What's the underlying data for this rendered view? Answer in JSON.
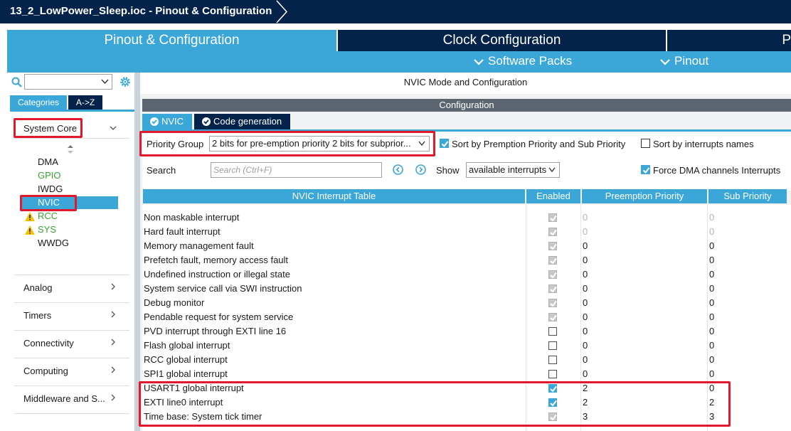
{
  "window": {
    "title": "13_2_LowPower_Sleep.ioc - Pinout & Configuration"
  },
  "main_tabs": [
    {
      "label": "Pinout & Configuration",
      "active": true
    },
    {
      "label": "Clock Configuration",
      "active": false
    },
    {
      "label": "P",
      "active": false
    }
  ],
  "sub_menu": {
    "software_packs": "Software Packs",
    "pinout": "Pinout"
  },
  "left": {
    "search_value": "",
    "category_tabs": [
      "Categories",
      "A->Z"
    ],
    "groups": {
      "system_core": "System Core",
      "analog": "Analog",
      "timers": "Timers",
      "connectivity": "Connectivity",
      "computing": "Computing",
      "middleware": "Middleware and S..."
    },
    "system_core_items": [
      {
        "label": "DMA",
        "status": "normal"
      },
      {
        "label": "GPIO",
        "status": "configured"
      },
      {
        "label": "IWDG",
        "status": "normal"
      },
      {
        "label": "NVIC",
        "status": "selected"
      },
      {
        "label": "RCC",
        "status": "warning"
      },
      {
        "label": "SYS",
        "status": "warning"
      },
      {
        "label": "WWDG",
        "status": "normal"
      }
    ]
  },
  "main": {
    "mode_title": "NVIC Mode and Configuration",
    "config_label": "Configuration",
    "sub_tabs": [
      "NVIC",
      "Code generation"
    ],
    "priority_group_label": "Priority Group",
    "priority_group_value": "2 bits for pre-emption priority 2 bits for subprior...",
    "sort_premption_label": "Sort by Premption Priority and Sub Priority",
    "sort_premption_checked": true,
    "sort_names_label": "Sort by interrupts names",
    "sort_names_checked": false,
    "search_label": "Search",
    "search_placeholder": "Search (Ctrl+F)",
    "show_label": "Show",
    "show_value": "available interrupts",
    "force_dma_label": "Force DMA channels Interrupts",
    "force_dma_checked": true
  },
  "table": {
    "headers": [
      "NVIC Interrupt Table",
      "Enabled",
      "Preemption Priority",
      "Sub Priority"
    ],
    "rows": [
      {
        "name": "Non maskable interrupt",
        "enabled": true,
        "enabled_locked": true,
        "preemption": "0",
        "sub": "0",
        "prio_locked": true
      },
      {
        "name": "Hard fault interrupt",
        "enabled": true,
        "enabled_locked": true,
        "preemption": "0",
        "sub": "0",
        "prio_locked": true
      },
      {
        "name": "Memory management fault",
        "enabled": true,
        "enabled_locked": true,
        "preemption": "0",
        "sub": "0",
        "prio_locked": false
      },
      {
        "name": "Prefetch fault, memory access fault",
        "enabled": true,
        "enabled_locked": true,
        "preemption": "0",
        "sub": "0",
        "prio_locked": false
      },
      {
        "name": "Undefined instruction or illegal state",
        "enabled": true,
        "enabled_locked": true,
        "preemption": "0",
        "sub": "0",
        "prio_locked": false
      },
      {
        "name": "System service call via SWI instruction",
        "enabled": true,
        "enabled_locked": true,
        "preemption": "0",
        "sub": "0",
        "prio_locked": false
      },
      {
        "name": "Debug monitor",
        "enabled": true,
        "enabled_locked": true,
        "preemption": "0",
        "sub": "0",
        "prio_locked": false
      },
      {
        "name": "Pendable request for system service",
        "enabled": true,
        "enabled_locked": true,
        "preemption": "0",
        "sub": "0",
        "prio_locked": false
      },
      {
        "name": "PVD interrupt through EXTI line 16",
        "enabled": false,
        "enabled_locked": false,
        "preemption": "0",
        "sub": "0",
        "prio_locked": false
      },
      {
        "name": "Flash global interrupt",
        "enabled": false,
        "enabled_locked": false,
        "preemption": "0",
        "sub": "0",
        "prio_locked": false
      },
      {
        "name": "RCC global interrupt",
        "enabled": false,
        "enabled_locked": false,
        "preemption": "0",
        "sub": "0",
        "prio_locked": false
      },
      {
        "name": "SPI1 global interrupt",
        "enabled": false,
        "enabled_locked": false,
        "preemption": "0",
        "sub": "0",
        "prio_locked": false
      },
      {
        "name": "USART1 global interrupt",
        "enabled": true,
        "enabled_locked": false,
        "preemption": "2",
        "sub": "0",
        "prio_locked": false
      },
      {
        "name": "EXTI line0 interrupt",
        "enabled": true,
        "enabled_locked": false,
        "preemption": "2",
        "sub": "2",
        "prio_locked": false
      },
      {
        "name": "Time base: System tick timer",
        "enabled": true,
        "enabled_locked": true,
        "preemption": "3",
        "sub": "3",
        "prio_locked": false
      }
    ]
  },
  "colors": {
    "title_bar": "#03234b",
    "accent": "#3ba7d9",
    "highlight_box": "#e0192c",
    "configured_green": "#3aa335",
    "warning_yellow": "#f2c500"
  },
  "icons": {
    "search": "search-icon",
    "settings": "gear-icon",
    "expand": "chevron-down-icon",
    "collapse": "chevron-right-icon",
    "warning": "warning-icon",
    "check": "check-circle-icon",
    "prev": "prev-icon",
    "next": "next-icon"
  }
}
